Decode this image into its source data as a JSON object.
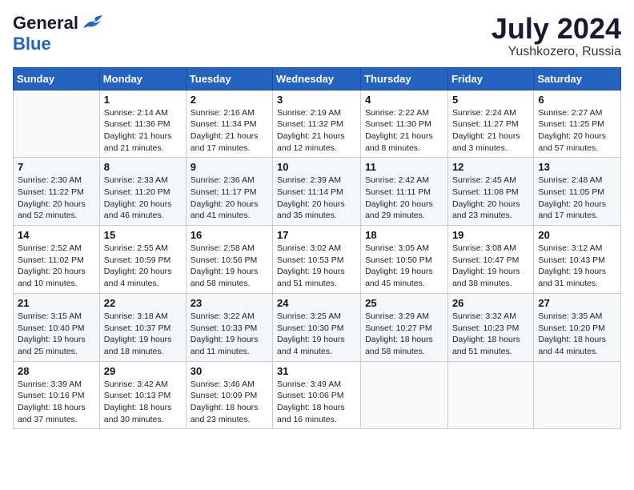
{
  "header": {
    "logo_general": "General",
    "logo_blue": "Blue",
    "month": "July 2024",
    "location": "Yushkozero, Russia"
  },
  "days_of_week": [
    "Sunday",
    "Monday",
    "Tuesday",
    "Wednesday",
    "Thursday",
    "Friday",
    "Saturday"
  ],
  "weeks": [
    [
      {
        "day": "",
        "info": ""
      },
      {
        "day": "1",
        "info": "Sunrise: 2:14 AM\nSunset: 11:36 PM\nDaylight: 21 hours\nand 21 minutes."
      },
      {
        "day": "2",
        "info": "Sunrise: 2:16 AM\nSunset: 11:34 PM\nDaylight: 21 hours\nand 17 minutes."
      },
      {
        "day": "3",
        "info": "Sunrise: 2:19 AM\nSunset: 11:32 PM\nDaylight: 21 hours\nand 12 minutes."
      },
      {
        "day": "4",
        "info": "Sunrise: 2:22 AM\nSunset: 11:30 PM\nDaylight: 21 hours\nand 8 minutes."
      },
      {
        "day": "5",
        "info": "Sunrise: 2:24 AM\nSunset: 11:27 PM\nDaylight: 21 hours\nand 3 minutes."
      },
      {
        "day": "6",
        "info": "Sunrise: 2:27 AM\nSunset: 11:25 PM\nDaylight: 20 hours\nand 57 minutes."
      }
    ],
    [
      {
        "day": "7",
        "info": "Sunrise: 2:30 AM\nSunset: 11:22 PM\nDaylight: 20 hours\nand 52 minutes."
      },
      {
        "day": "8",
        "info": "Sunrise: 2:33 AM\nSunset: 11:20 PM\nDaylight: 20 hours\nand 46 minutes."
      },
      {
        "day": "9",
        "info": "Sunrise: 2:36 AM\nSunset: 11:17 PM\nDaylight: 20 hours\nand 41 minutes."
      },
      {
        "day": "10",
        "info": "Sunrise: 2:39 AM\nSunset: 11:14 PM\nDaylight: 20 hours\nand 35 minutes."
      },
      {
        "day": "11",
        "info": "Sunrise: 2:42 AM\nSunset: 11:11 PM\nDaylight: 20 hours\nand 29 minutes."
      },
      {
        "day": "12",
        "info": "Sunrise: 2:45 AM\nSunset: 11:08 PM\nDaylight: 20 hours\nand 23 minutes."
      },
      {
        "day": "13",
        "info": "Sunrise: 2:48 AM\nSunset: 11:05 PM\nDaylight: 20 hours\nand 17 minutes."
      }
    ],
    [
      {
        "day": "14",
        "info": "Sunrise: 2:52 AM\nSunset: 11:02 PM\nDaylight: 20 hours\nand 10 minutes."
      },
      {
        "day": "15",
        "info": "Sunrise: 2:55 AM\nSunset: 10:59 PM\nDaylight: 20 hours\nand 4 minutes."
      },
      {
        "day": "16",
        "info": "Sunrise: 2:58 AM\nSunset: 10:56 PM\nDaylight: 19 hours\nand 58 minutes."
      },
      {
        "day": "17",
        "info": "Sunrise: 3:02 AM\nSunset: 10:53 PM\nDaylight: 19 hours\nand 51 minutes."
      },
      {
        "day": "18",
        "info": "Sunrise: 3:05 AM\nSunset: 10:50 PM\nDaylight: 19 hours\nand 45 minutes."
      },
      {
        "day": "19",
        "info": "Sunrise: 3:08 AM\nSunset: 10:47 PM\nDaylight: 19 hours\nand 38 minutes."
      },
      {
        "day": "20",
        "info": "Sunrise: 3:12 AM\nSunset: 10:43 PM\nDaylight: 19 hours\nand 31 minutes."
      }
    ],
    [
      {
        "day": "21",
        "info": "Sunrise: 3:15 AM\nSunset: 10:40 PM\nDaylight: 19 hours\nand 25 minutes."
      },
      {
        "day": "22",
        "info": "Sunrise: 3:18 AM\nSunset: 10:37 PM\nDaylight: 19 hours\nand 18 minutes."
      },
      {
        "day": "23",
        "info": "Sunrise: 3:22 AM\nSunset: 10:33 PM\nDaylight: 19 hours\nand 11 minutes."
      },
      {
        "day": "24",
        "info": "Sunrise: 3:25 AM\nSunset: 10:30 PM\nDaylight: 19 hours\nand 4 minutes."
      },
      {
        "day": "25",
        "info": "Sunrise: 3:29 AM\nSunset: 10:27 PM\nDaylight: 18 hours\nand 58 minutes."
      },
      {
        "day": "26",
        "info": "Sunrise: 3:32 AM\nSunset: 10:23 PM\nDaylight: 18 hours\nand 51 minutes."
      },
      {
        "day": "27",
        "info": "Sunrise: 3:35 AM\nSunset: 10:20 PM\nDaylight: 18 hours\nand 44 minutes."
      }
    ],
    [
      {
        "day": "28",
        "info": "Sunrise: 3:39 AM\nSunset: 10:16 PM\nDaylight: 18 hours\nand 37 minutes."
      },
      {
        "day": "29",
        "info": "Sunrise: 3:42 AM\nSunset: 10:13 PM\nDaylight: 18 hours\nand 30 minutes."
      },
      {
        "day": "30",
        "info": "Sunrise: 3:46 AM\nSunset: 10:09 PM\nDaylight: 18 hours\nand 23 minutes."
      },
      {
        "day": "31",
        "info": "Sunrise: 3:49 AM\nSunset: 10:06 PM\nDaylight: 18 hours\nand 16 minutes."
      },
      {
        "day": "",
        "info": ""
      },
      {
        "day": "",
        "info": ""
      },
      {
        "day": "",
        "info": ""
      }
    ]
  ]
}
